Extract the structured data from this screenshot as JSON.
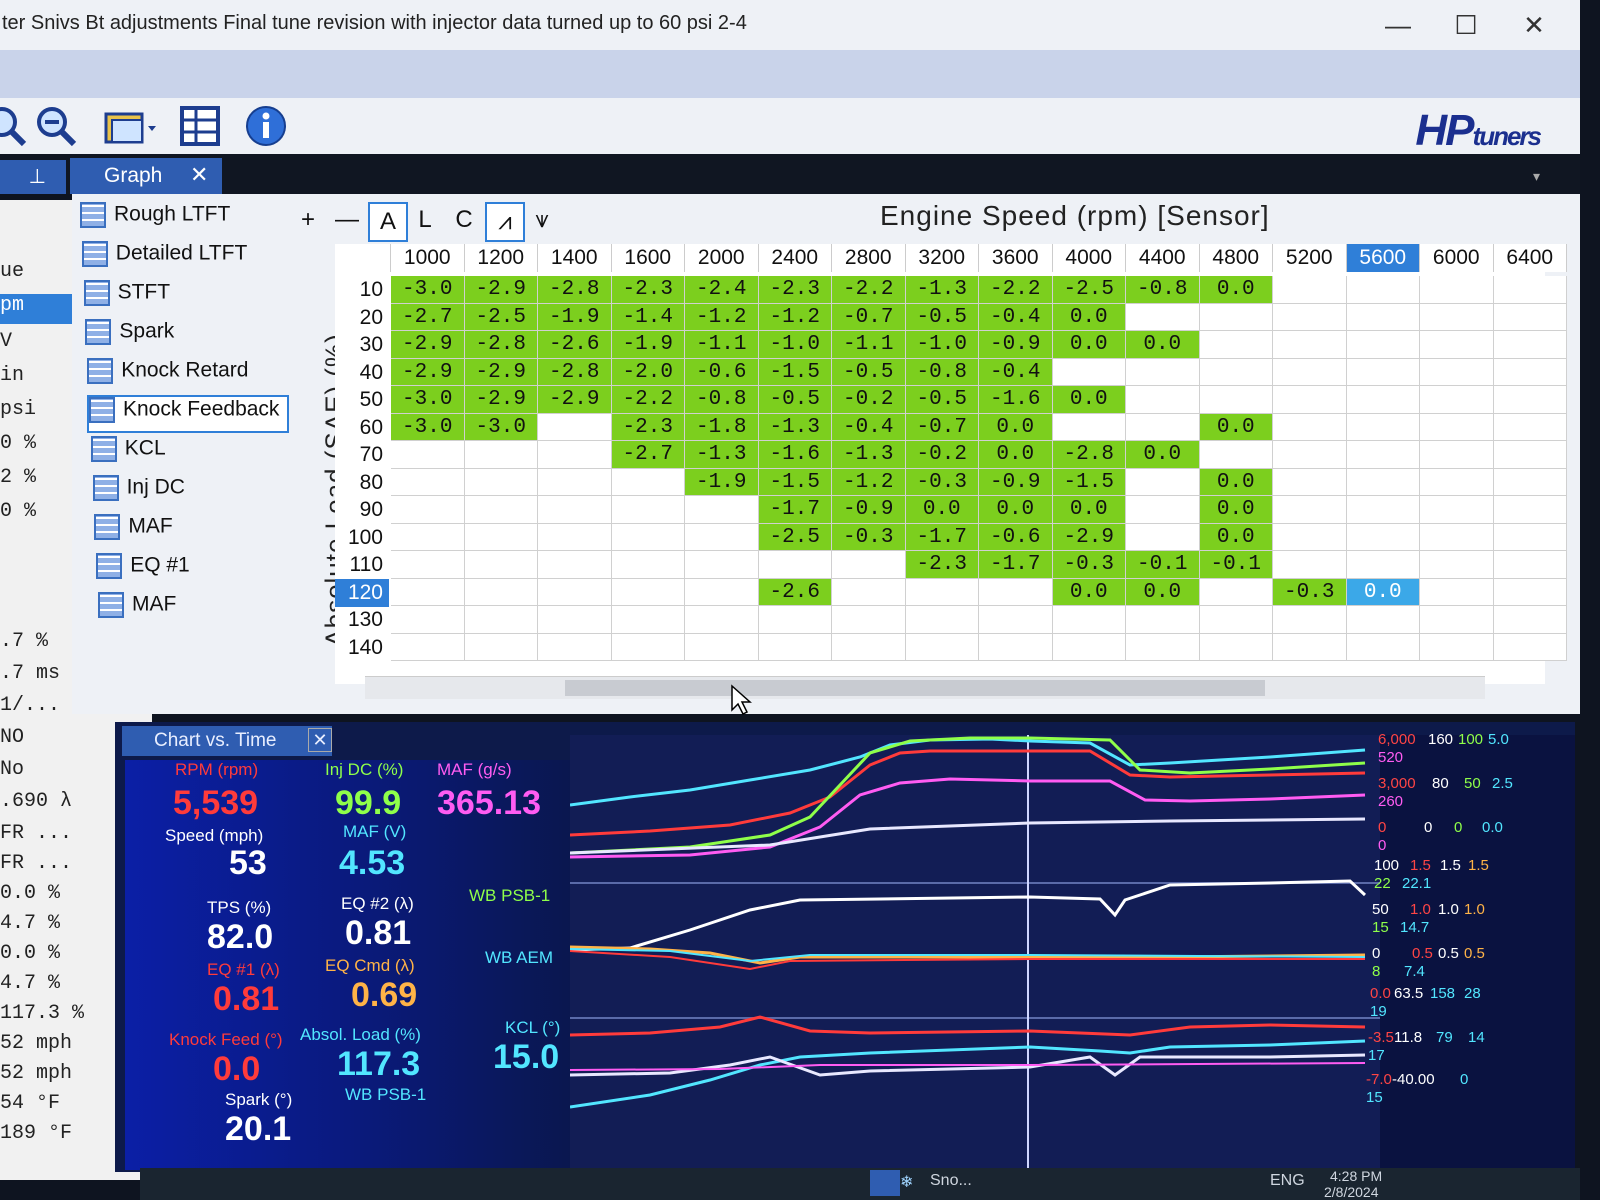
{
  "window": {
    "title": "ter Snivs Bt adjustments Final tune revision with injector data turned up to 60 psi 2-4",
    "controls": [
      "—",
      "☐",
      "✕"
    ]
  },
  "toolbar": {
    "icons": [
      "zoom-in-icon",
      "zoom-out-icon",
      "open-folder-icon",
      "table-icon",
      "info-icon"
    ],
    "logo_main": "HP",
    "logo_sub": "tuners"
  },
  "tabs": {
    "graph": "Graph",
    "close": "✕",
    "pin": "⊥"
  },
  "left_panel": {
    "rows": [
      {
        "text": "ue",
        "sel": false
      },
      {
        "text": "pm",
        "sel": true
      },
      {
        "text": " V",
        "sel": false
      },
      {
        "text": "in",
        "sel": false
      },
      {
        "text": "psi",
        "sel": false
      },
      {
        "text": "0 %",
        "sel": false
      },
      {
        "text": "2 %",
        "sel": false
      },
      {
        "text": "0 %",
        "sel": false
      },
      {
        "text": ".7 %",
        "sel": false
      },
      {
        "text": ".7 ms",
        "sel": false
      },
      {
        "text": "1/...",
        "sel": false
      },
      {
        "text": "  NO",
        "sel": false
      },
      {
        "text": "  No",
        "sel": false
      },
      {
        "text": ".690 λ",
        "sel": false
      },
      {
        "text": "FR ...",
        "sel": false
      },
      {
        "text": "FR ...",
        "sel": false
      },
      {
        "text": " 0.0 %",
        "sel": false
      },
      {
        "text": " 4.7 %",
        "sel": false
      },
      {
        "text": " 0.0 %",
        "sel": false
      },
      {
        "text": " 4.7 %",
        "sel": false
      },
      {
        "text": "117.3 %",
        "sel": false
      },
      {
        "text": " 52 mph",
        "sel": false
      },
      {
        "text": " 52 mph",
        "sel": false
      },
      {
        "text": "  54 °F",
        "sel": false
      },
      {
        "text": " 189 °F",
        "sel": false
      }
    ]
  },
  "table_list": [
    {
      "label": "Rough LTFT",
      "sel": false
    },
    {
      "label": "Detailed LTFT",
      "sel": false
    },
    {
      "label": "STFT",
      "sel": false
    },
    {
      "label": "Spark",
      "sel": false
    },
    {
      "label": "Knock Retard",
      "sel": false
    },
    {
      "label": "Knock Feedback",
      "sel": true
    },
    {
      "label": "KCL",
      "sel": false
    },
    {
      "label": "Inj DC",
      "sel": false
    },
    {
      "label": "MAF",
      "sel": false
    },
    {
      "label": "EQ #1",
      "sel": false
    },
    {
      "label": "MAF",
      "sel": false
    }
  ],
  "graph_tools": [
    "+",
    "—",
    "A",
    "L",
    "C",
    "⩘",
    "⩛"
  ],
  "table": {
    "x_title": "Engine Speed (rpm) [Sensor]",
    "y_title": "Absolute Load (SAE) (%)",
    "columns": [
      "1000",
      "1200",
      "1400",
      "1600",
      "2000",
      "2400",
      "2800",
      "3200",
      "3600",
      "4000",
      "4400",
      "4800",
      "5200",
      "5600",
      "6000",
      "6400"
    ],
    "selected_column": "5600",
    "rows": [
      "10",
      "20",
      "30",
      "40",
      "50",
      "60",
      "70",
      "80",
      "90",
      "100",
      "110",
      "120",
      "130",
      "140"
    ],
    "selected_row": "120",
    "cells": [
      [
        "-3.0",
        "-2.9",
        "-2.8",
        "-2.3",
        "-2.4",
        "-2.3",
        "-2.2",
        "-1.3",
        "-2.2",
        "-2.5",
        "-0.8",
        "0.0",
        "",
        "",
        "",
        ""
      ],
      [
        "-2.7",
        "-2.5",
        "-1.9",
        "-1.4",
        "-1.2",
        "-1.2",
        "-0.7",
        "-0.5",
        "-0.4",
        "0.0",
        "",
        "",
        "",
        "",
        "",
        ""
      ],
      [
        "-2.9",
        "-2.8",
        "-2.6",
        "-1.9",
        "-1.1",
        "-1.0",
        "-1.1",
        "-1.0",
        "-0.9",
        "0.0",
        "0.0",
        "",
        "",
        "",
        "",
        ""
      ],
      [
        "-2.9",
        "-2.9",
        "-2.8",
        "-2.0",
        "-0.6",
        "-1.5",
        "-0.5",
        "-0.8",
        "-0.4",
        "",
        "",
        "",
        "",
        "",
        "",
        ""
      ],
      [
        "-3.0",
        "-2.9",
        "-2.9",
        "-2.2",
        "-0.8",
        "-0.5",
        "-0.2",
        "-0.5",
        "-1.6",
        "0.0",
        "",
        "",
        "",
        "",
        "",
        ""
      ],
      [
        "-3.0",
        "-3.0",
        "",
        "-2.3",
        "-1.8",
        "-1.3",
        "-0.4",
        "-0.7",
        "0.0",
        "",
        "",
        "0.0",
        "",
        "",
        "",
        ""
      ],
      [
        "",
        "",
        "",
        "-2.7",
        "-1.3",
        "-1.6",
        "-1.3",
        "-0.2",
        "0.0",
        "-2.8",
        "0.0",
        "",
        "",
        "",
        "",
        ""
      ],
      [
        "",
        "",
        "",
        "",
        "-1.9",
        "-1.5",
        "-1.2",
        "-0.3",
        "-0.9",
        "-1.5",
        "",
        "0.0",
        "",
        "",
        "",
        ""
      ],
      [
        "",
        "",
        "",
        "",
        "",
        "-1.7",
        "-0.9",
        "0.0",
        "0.0",
        "0.0",
        "",
        "0.0",
        "",
        "",
        "",
        ""
      ],
      [
        "",
        "",
        "",
        "",
        "",
        "-2.5",
        "-0.3",
        "-1.7",
        "-0.6",
        "-2.9",
        "",
        "0.0",
        "",
        "",
        "",
        ""
      ],
      [
        "",
        "",
        "",
        "",
        "",
        "",
        "",
        "-2.3",
        "-1.7",
        "-0.3",
        "-0.1",
        "-0.1",
        "",
        "",
        "",
        ""
      ],
      [
        "",
        "",
        "",
        "",
        "",
        "-2.6",
        "",
        "",
        "",
        "0.0",
        "0.0",
        "",
        "-0.3",
        "0.0",
        "",
        ""
      ],
      [
        "",
        "",
        "",
        "",
        "",
        "",
        "",
        "",
        "",
        "",
        "",
        "",
        "",
        "",
        "",
        ""
      ],
      [
        "",
        "",
        "",
        "",
        "",
        "",
        "",
        "",
        "",
        "",
        "",
        "",
        "",
        "",
        "",
        ""
      ]
    ]
  },
  "chart_panel": {
    "tab": "Chart vs. Time",
    "close": "✕",
    "gauges": [
      {
        "label": "RPM (rpm)",
        "value": "5,539",
        "label_color": "#ff3b3b",
        "value_color": "#ff3b3b"
      },
      {
        "label": "Inj DC (%)",
        "value": "99.9",
        "label_color": "#8fff4a",
        "value_color": "#8fff4a"
      },
      {
        "label": "MAF (g/s)",
        "value": "365.13",
        "label_color": "#ff5cf2",
        "value_color": "#ff5cf2"
      },
      {
        "label": "Speed (mph)",
        "value": "53",
        "label_color": "#ffffff",
        "value_color": "#ffffff"
      },
      {
        "label": "MAF (V)",
        "value": "4.53",
        "label_color": "#52e6ff",
        "value_color": "#52e6ff"
      },
      {
        "label": "TPS (%)",
        "value": "82.0",
        "label_color": "#ffffff",
        "value_color": "#ffffff"
      },
      {
        "label": "EQ #2 (λ)",
        "value": "0.81",
        "label_color": "#ffffff",
        "value_color": "#ffffff"
      },
      {
        "label": "WB PSB-1",
        "value": "",
        "label_color": "#8fff4a",
        "value_color": "#8fff4a"
      },
      {
        "label": "EQ #1 (λ)",
        "value": "0.81",
        "label_color": "#ff3b3b",
        "value_color": "#ff3b3b"
      },
      {
        "label": "EQ Cmd (λ)",
        "value": "0.69",
        "label_color": "#ffb347",
        "value_color": "#ffb347"
      },
      {
        "label": "WB AEM",
        "value": "",
        "label_color": "#52e6ff",
        "value_color": "#52e6ff"
      },
      {
        "label": "Knock Feed (°)",
        "value": "0.0",
        "label_color": "#ff3b3b",
        "value_color": "#ff3b3b"
      },
      {
        "label": "Absol. Load (%)",
        "value": "117.3",
        "label_color": "#52e6ff",
        "value_color": "#52e6ff"
      },
      {
        "label": "KCL (°)",
        "value": "15.0",
        "label_color": "#52e6ff",
        "value_color": "#52e6ff"
      },
      {
        "label": "Spark (°)",
        "value": "20.1",
        "label_color": "#ffffff",
        "value_color": "#ffffff"
      },
      {
        "label": "WB PSB-1",
        "value": "",
        "label_color": "#52e6ff",
        "value_color": "#52e6ff"
      }
    ],
    "scales": [
      {
        "text": "6,000",
        "color": "#ff4545"
      },
      {
        "text": "160",
        "color": "#ffffff"
      },
      {
        "text": "100",
        "color": "#8fff4a"
      },
      {
        "text": "5.0",
        "color": "#52e6ff"
      },
      {
        "text": "520",
        "color": "#ff5cf2"
      },
      {
        "text": "3,000",
        "color": "#ff4545"
      },
      {
        "text": "80",
        "color": "#ffffff"
      },
      {
        "text": "50",
        "color": "#8fff4a"
      },
      {
        "text": "2.5",
        "color": "#52e6ff"
      },
      {
        "text": "260",
        "color": "#ff5cf2"
      },
      {
        "text": "0",
        "color": "#ff4545"
      },
      {
        "text": "0",
        "color": "#ffffff"
      },
      {
        "text": "0",
        "color": "#8fff4a"
      },
      {
        "text": "0.0",
        "color": "#52e6ff"
      },
      {
        "text": "0",
        "color": "#ff5cf2"
      },
      {
        "text": "100",
        "color": "#ffffff"
      },
      {
        "text": "1.5",
        "color": "#ff4545"
      },
      {
        "text": "1.5",
        "color": "#ffffff"
      },
      {
        "text": "1.5",
        "color": "#ffb347"
      },
      {
        "text": "22",
        "color": "#8fff4a"
      },
      {
        "text": "22.1",
        "color": "#52e6ff"
      },
      {
        "text": "50",
        "color": "#ffffff"
      },
      {
        "text": "1.0",
        "color": "#ff4545"
      },
      {
        "text": "1.0",
        "color": "#ffffff"
      },
      {
        "text": "1.0",
        "color": "#ffb347"
      },
      {
        "text": "15",
        "color": "#8fff4a"
      },
      {
        "text": "14.7",
        "color": "#52e6ff"
      },
      {
        "text": "0",
        "color": "#ffffff"
      },
      {
        "text": "0.5",
        "color": "#ff4545"
      },
      {
        "text": "0.5",
        "color": "#ffffff"
      },
      {
        "text": "0.5",
        "color": "#ffb347"
      },
      {
        "text": "8",
        "color": "#8fff4a"
      },
      {
        "text": "7.4",
        "color": "#52e6ff"
      },
      {
        "text": "0.0",
        "color": "#ff4545"
      },
      {
        "text": "63.5",
        "color": "#ffffff"
      },
      {
        "text": "158",
        "color": "#52e6ff"
      },
      {
        "text": "28",
        "color": "#52e6ff"
      },
      {
        "text": "19",
        "color": "#52e6ff"
      },
      {
        "text": "-3.5",
        "color": "#ff4545"
      },
      {
        "text": "11.8",
        "color": "#ffffff"
      },
      {
        "text": "79",
        "color": "#52e6ff"
      },
      {
        "text": "14",
        "color": "#52e6ff"
      },
      {
        "text": "17",
        "color": "#52e6ff"
      },
      {
        "text": "-7.0",
        "color": "#ff4545"
      },
      {
        "text": "-40.00",
        "color": "#ffffff"
      },
      {
        "text": "0",
        "color": "#52e6ff"
      },
      {
        "text": "15",
        "color": "#52e6ff"
      }
    ]
  },
  "taskbar": {
    "snow": "Sno...",
    "lang": "ENG",
    "time": "4:28 PM",
    "date": "2/8/2024"
  },
  "colors": {
    "accent": "#2f7fd8",
    "cell_green": "#7ccf1e",
    "cell_blue": "#3ba8e8",
    "chart_bg": "#121d55"
  }
}
